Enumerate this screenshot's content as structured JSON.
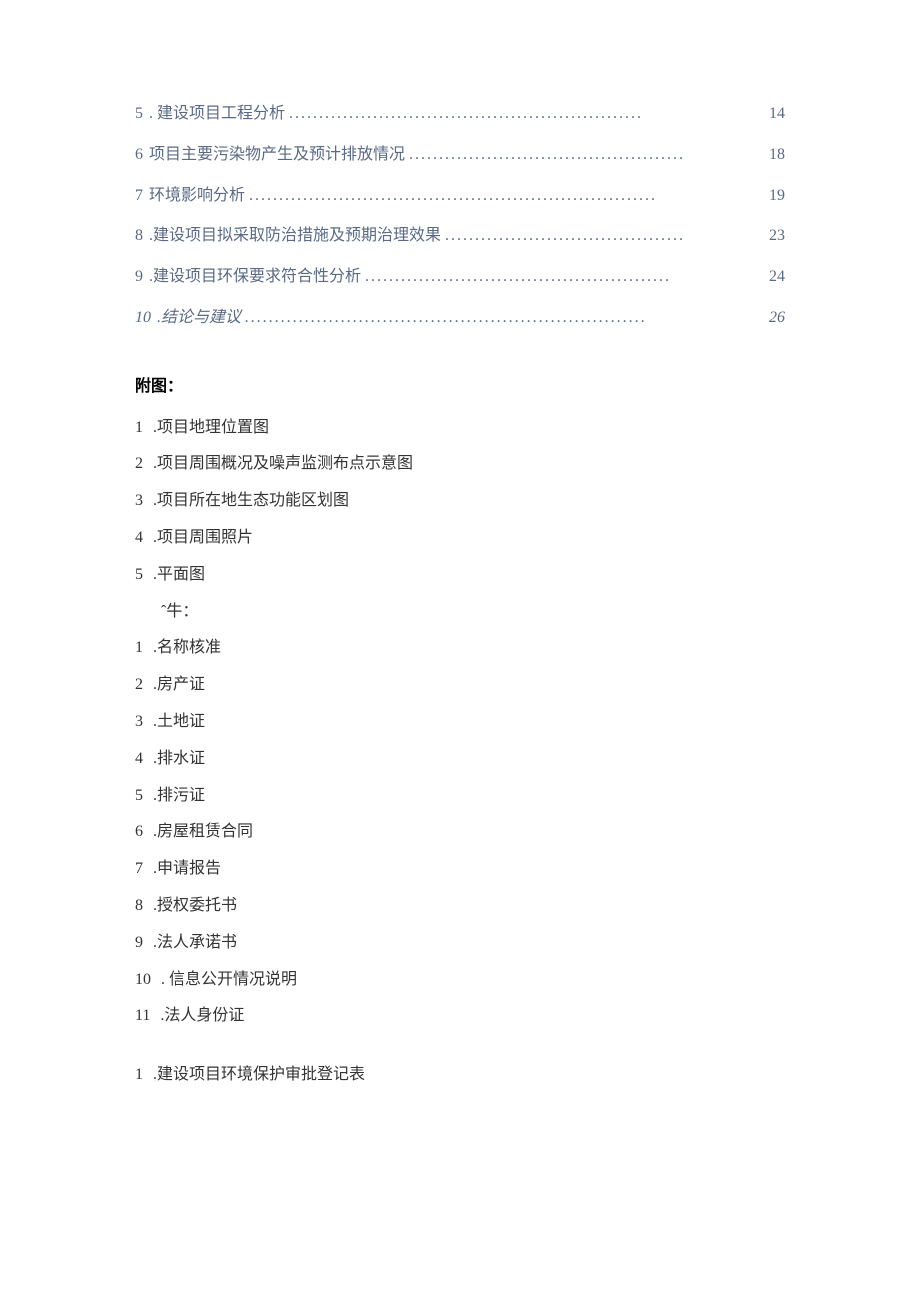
{
  "toc": {
    "items": [
      {
        "num": "5",
        "title": ". 建设项目工程分析",
        "dots": "...........................................................",
        "page": "14",
        "italic": false
      },
      {
        "num": "6",
        "title": "项目主要污染物产生及预计排放情况",
        "dots": " ..............................................",
        "page": "18",
        "italic": false
      },
      {
        "num": "7",
        "title": "环境影响分析",
        "dots": " ....................................................................",
        "page": "19",
        "italic": false
      },
      {
        "num": "8",
        "title": " .建设项目拟采取防治措施及预期治理效果",
        "dots": " ........................................",
        "page": "23",
        "italic": false
      },
      {
        "num": "9",
        "title": " .建设项目环保要求符合性分析",
        "dots": " ...................................................",
        "page": "24",
        "italic": false
      },
      {
        "num": "10",
        "title": " .结论与建议",
        "dots": " ...................................................................",
        "page": "26",
        "italic": true
      }
    ]
  },
  "headings": {
    "figures": "附图：",
    "attachments": "   ˆ牛："
  },
  "figures": [
    {
      "num": "1",
      "text": " .项目地理位置图"
    },
    {
      "num": "2",
      "text": " .项目周围概况及噪声监测布点示意图"
    },
    {
      "num": "3",
      "text": " .项目所在地生态功能区划图"
    },
    {
      "num": "4",
      "text": " .项目周围照片"
    },
    {
      "num": "5",
      "text": " .平面图"
    }
  ],
  "attachments": [
    {
      "num": "1",
      "text": " .名称核准"
    },
    {
      "num": "2",
      "text": " .房产证"
    },
    {
      "num": "3",
      "text": " .土地证"
    },
    {
      "num": "4",
      "text": " .排水证"
    },
    {
      "num": "5",
      "text": " .排污证"
    },
    {
      "num": "6",
      "text": " .房屋租赁合同"
    },
    {
      "num": "7",
      "text": " .申请报告"
    },
    {
      "num": "8",
      "text": " .授权委托书"
    },
    {
      "num": "9",
      "text": " .法人承诺书"
    },
    {
      "num": "10",
      "text": " . 信息公开情况说明"
    },
    {
      "num": "11",
      "text": " .法人身份证"
    }
  ],
  "appendix": [
    {
      "num": "1",
      "text": " .建设项目环境保护审批登记表"
    }
  ]
}
